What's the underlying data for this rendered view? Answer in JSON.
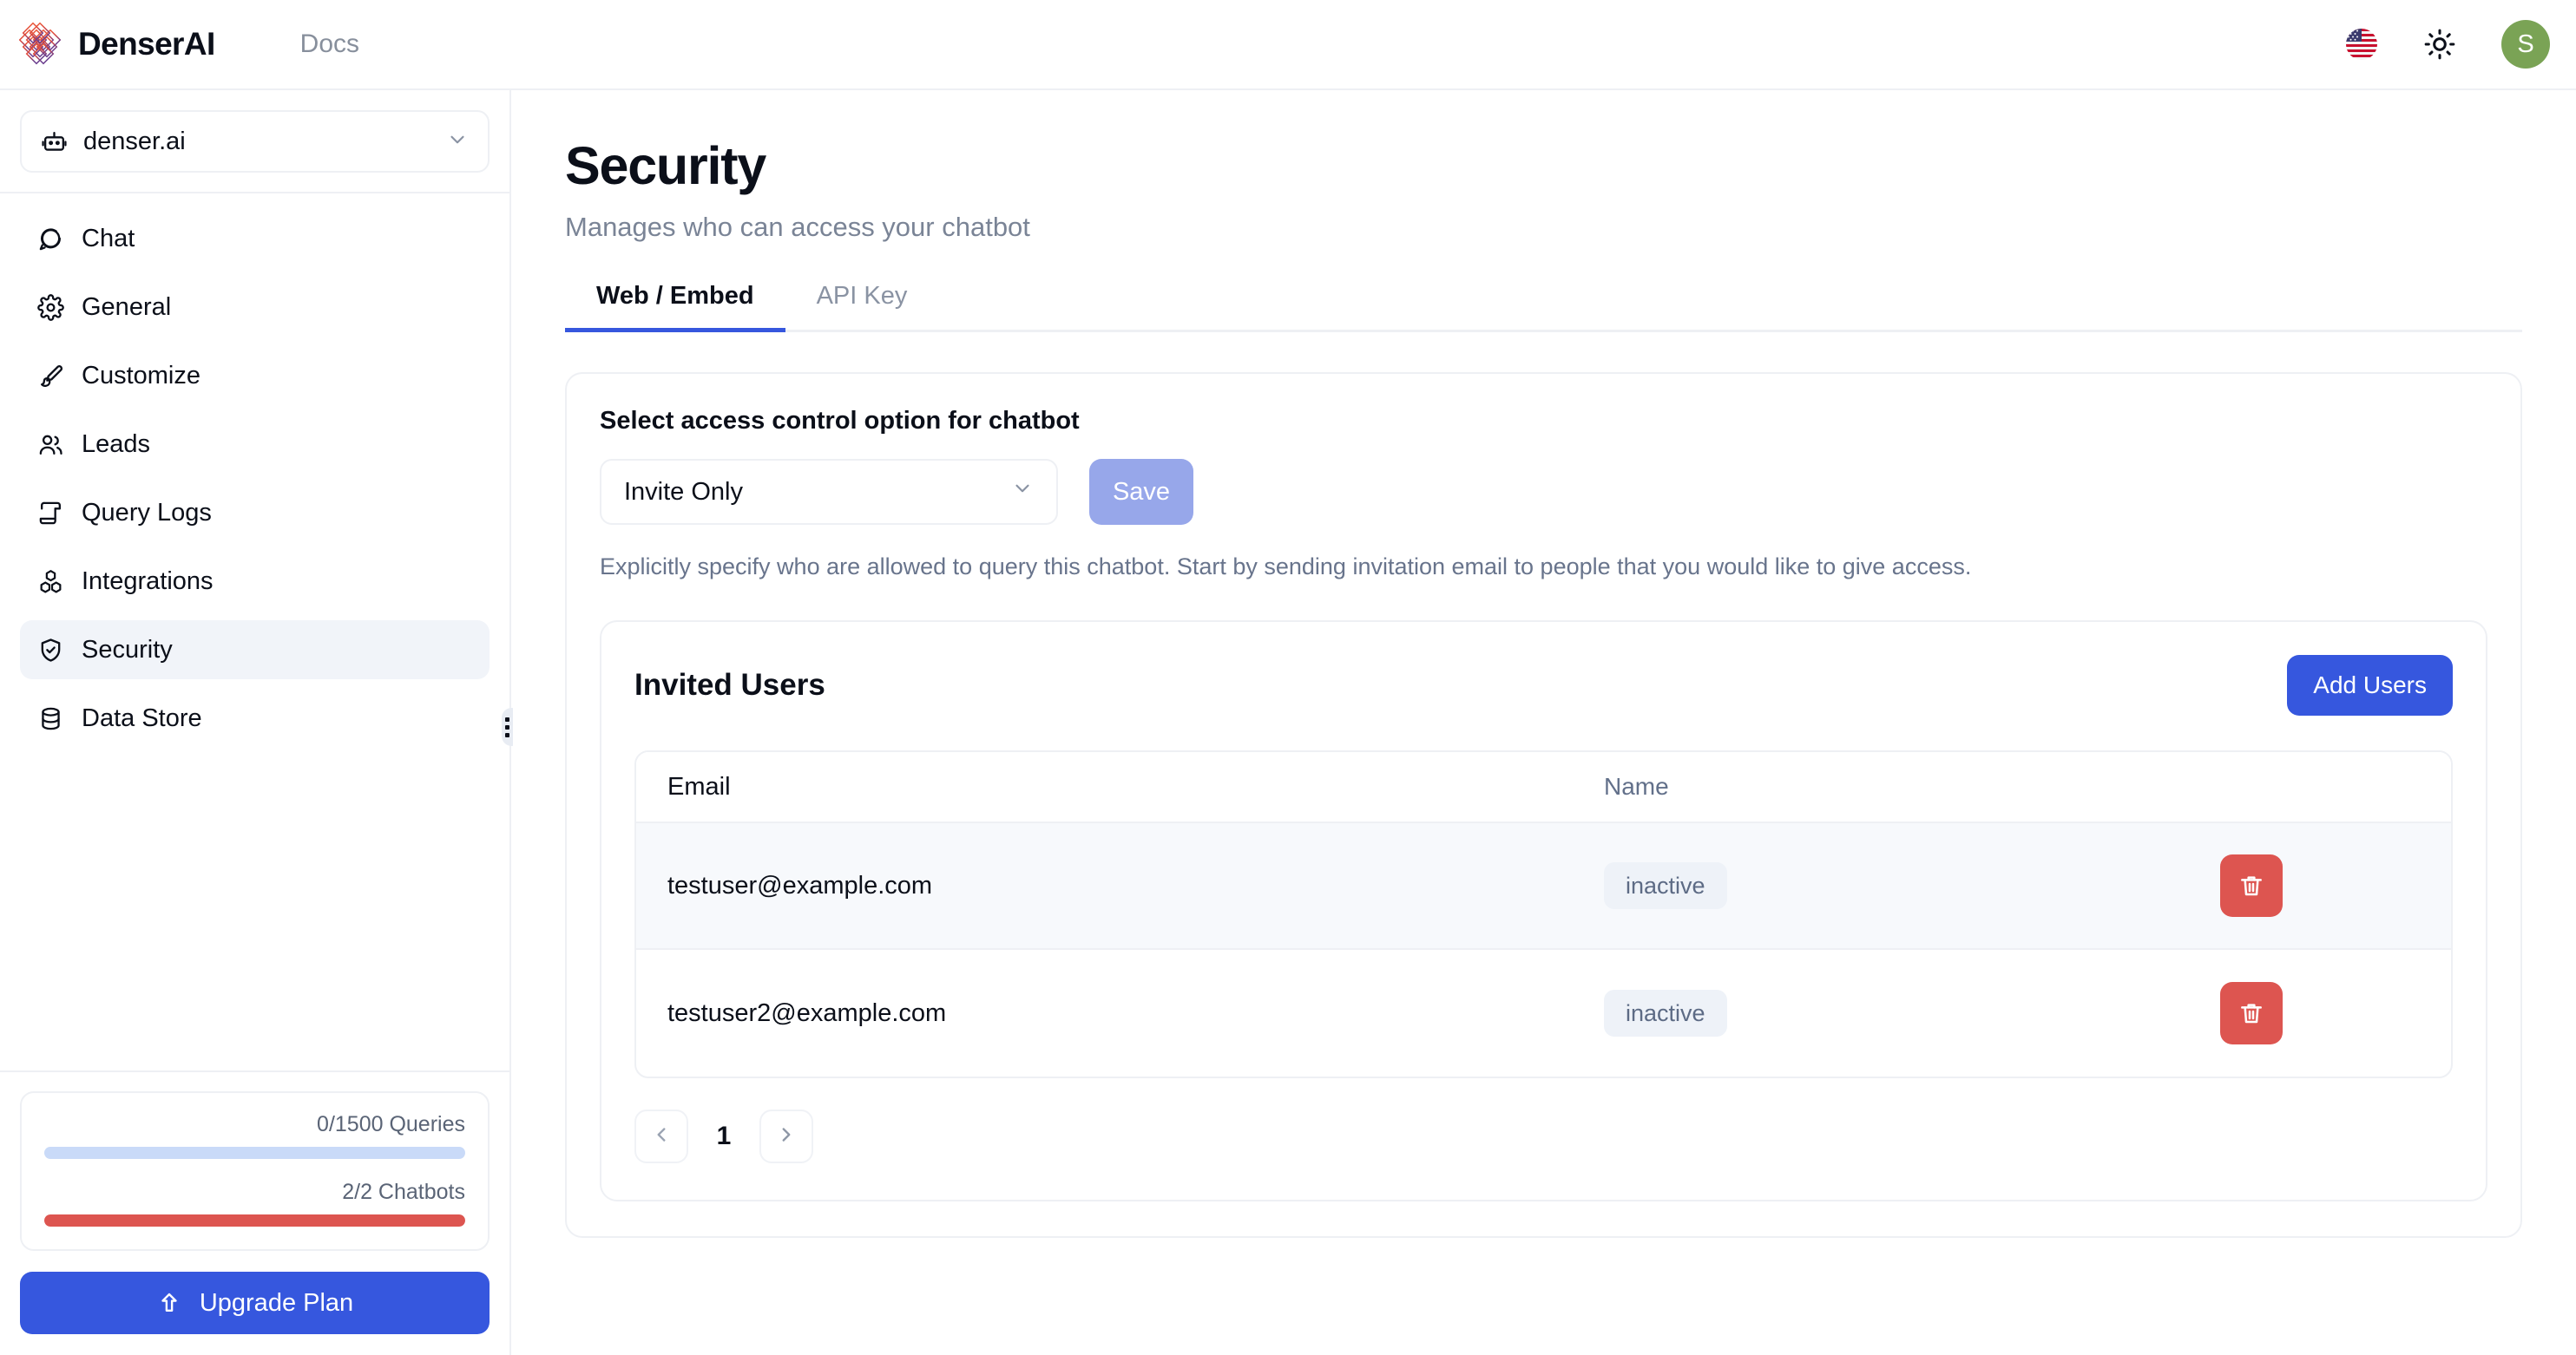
{
  "topbar": {
    "brand_name": "DenserAI",
    "logo_icon": "denser-diamond-lattice-logo",
    "docs_label": "Docs",
    "language_icon": "us-flag-icon",
    "theme_icon": "sun-icon",
    "avatar_initial": "S",
    "avatar_color": "#7aa355"
  },
  "sidebar": {
    "bot_selector": {
      "icon": "bot-icon",
      "label": "denser.ai",
      "chevron": "chevron-down-icon"
    },
    "items": [
      {
        "label": "Chat",
        "icon": "chat-bubble-icon",
        "active": false
      },
      {
        "label": "General",
        "icon": "gear-icon",
        "active": false
      },
      {
        "label": "Customize",
        "icon": "paintbrush-icon",
        "active": false
      },
      {
        "label": "Leads",
        "icon": "users-icon",
        "active": false
      },
      {
        "label": "Query Logs",
        "icon": "scroll-icon",
        "active": false
      },
      {
        "label": "Integrations",
        "icon": "cubes-icon",
        "active": false
      },
      {
        "label": "Security",
        "icon": "shield-check-icon",
        "active": true
      },
      {
        "label": "Data Store",
        "icon": "database-icon",
        "active": false
      }
    ],
    "resize_handle_icon": "drag-grip-icon",
    "usage": {
      "queries_label": "0/1500 Queries",
      "queries_percent": 0,
      "queries_track_color": "#c9daf8",
      "chatbots_label": "2/2 Chatbots",
      "chatbots_percent": 100,
      "chatbots_fill_color": "#dd5550"
    },
    "upgrade_button": {
      "label": "Upgrade Plan",
      "icon": "arrow-up-icon",
      "color": "#3657de"
    }
  },
  "main": {
    "title": "Security",
    "subtitle": "Manages who can access your chatbot",
    "tabs": [
      {
        "label": "Web / Embed",
        "active": true
      },
      {
        "label": "API Key",
        "active": false
      }
    ],
    "accent_color": "#3657de",
    "access_control": {
      "label": "Select access control option for chatbot",
      "selected_option": "Invite Only",
      "chevron": "chevron-down-icon",
      "save_label": "Save",
      "save_color": "#97a7ea",
      "helper_text": "Explicitly specify who are allowed to query this chatbot. Start by sending invitation email to people that you would like to give access."
    },
    "invited_users": {
      "title": "Invited Users",
      "add_button_label": "Add Users",
      "columns": [
        "Email",
        "Name"
      ],
      "rows": [
        {
          "email": "testuser@example.com",
          "name": "inactive",
          "delete_icon": "trash-icon"
        },
        {
          "email": "testuser2@example.com",
          "name": "inactive",
          "delete_icon": "trash-icon"
        }
      ],
      "badge_color": "#eef2f8",
      "delete_color": "#dd5550",
      "pagination": {
        "prev_icon": "chevron-left-icon",
        "next_icon": "chevron-right-icon",
        "current_page": "1"
      }
    }
  }
}
